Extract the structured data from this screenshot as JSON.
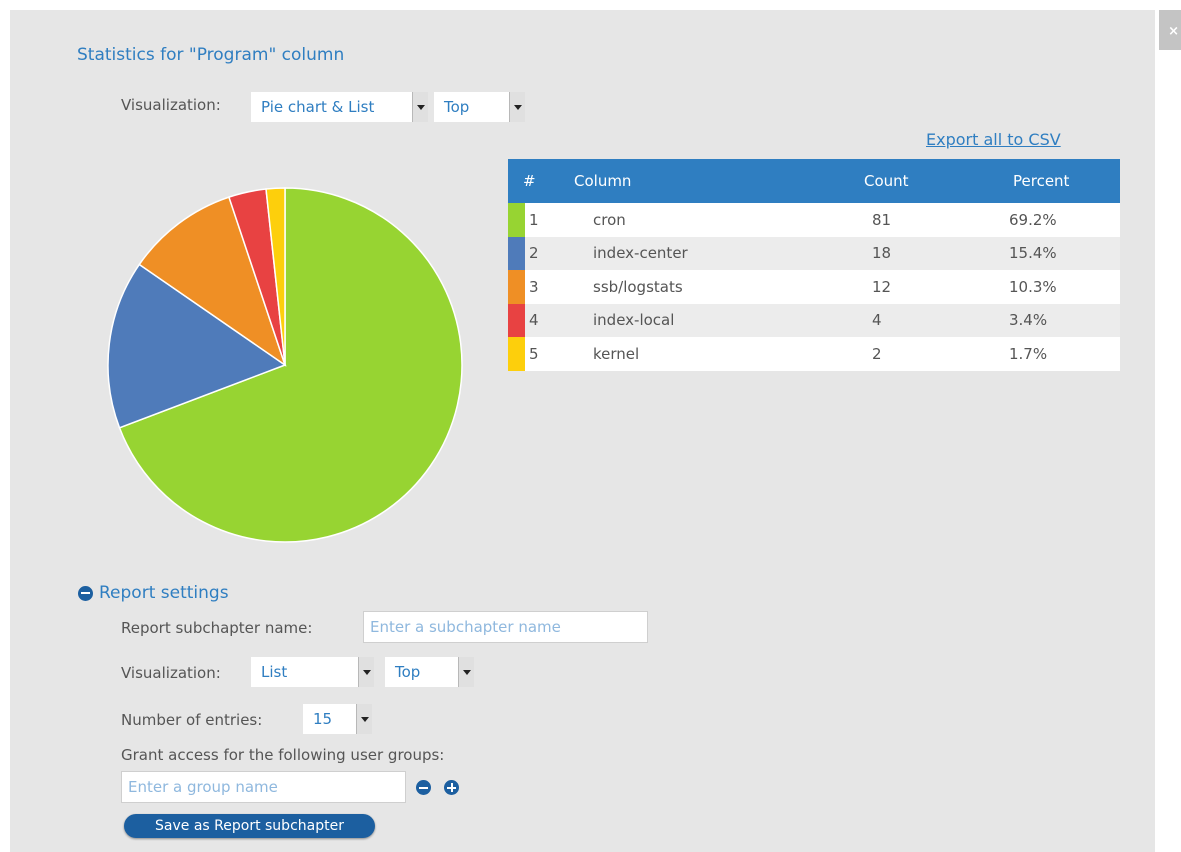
{
  "dialog": {
    "title": "Statistics for \"Program\" column",
    "close_label": "×"
  },
  "visualization": {
    "label": "Visualization:",
    "type_value": "Pie chart & List",
    "order_value": "Top"
  },
  "export_label": "Export all to CSV",
  "table": {
    "headers": [
      "#",
      "Column",
      "Count",
      "Percent"
    ],
    "rows": [
      {
        "rank": "1",
        "name": "cron",
        "count": "81",
        "percent": "69.2%",
        "color": "#97d432"
      },
      {
        "rank": "2",
        "name": "index-center",
        "count": "18",
        "percent": "15.4%",
        "color": "#4f7bba"
      },
      {
        "rank": "3",
        "name": "ssb/logstats",
        "count": "12",
        "percent": "10.3%",
        "color": "#ef8f25"
      },
      {
        "rank": "4",
        "name": "index-local",
        "count": "4",
        "percent": "3.4%",
        "color": "#e84242"
      },
      {
        "rank": "5",
        "name": "kernel",
        "count": "2",
        "percent": "1.7%",
        "color": "#fdcf0c"
      }
    ]
  },
  "chart_data": {
    "type": "pie",
    "categories": [
      "cron",
      "index-center",
      "ssb/logstats",
      "index-local",
      "kernel"
    ],
    "values": [
      81,
      18,
      12,
      4,
      2
    ],
    "colors": [
      "#97d432",
      "#4f7bba",
      "#ef8f25",
      "#e84242",
      "#fdcf0c"
    ]
  },
  "report_settings": {
    "toggle_label": "Report settings",
    "subchapter_label": "Report subchapter name:",
    "subchapter_placeholder": "Enter a subchapter name",
    "visualization_label": "Visualization:",
    "visualization_type": "List",
    "visualization_order": "Top",
    "entries_label": "Number of entries:",
    "entries_value": "15",
    "groups_label": "Grant access for the following user groups:",
    "group_placeholder": "Enter a group name",
    "save_label": "Save as Report subchapter"
  },
  "colors": {
    "accent": "#2f7ec1",
    "dark_button": "#1c5fa0",
    "panel_bg": "#e6e6e6"
  },
  "icons": [
    "close-icon",
    "dropdown-arrow-icon",
    "minus-circle-icon",
    "plus-circle-icon"
  ]
}
